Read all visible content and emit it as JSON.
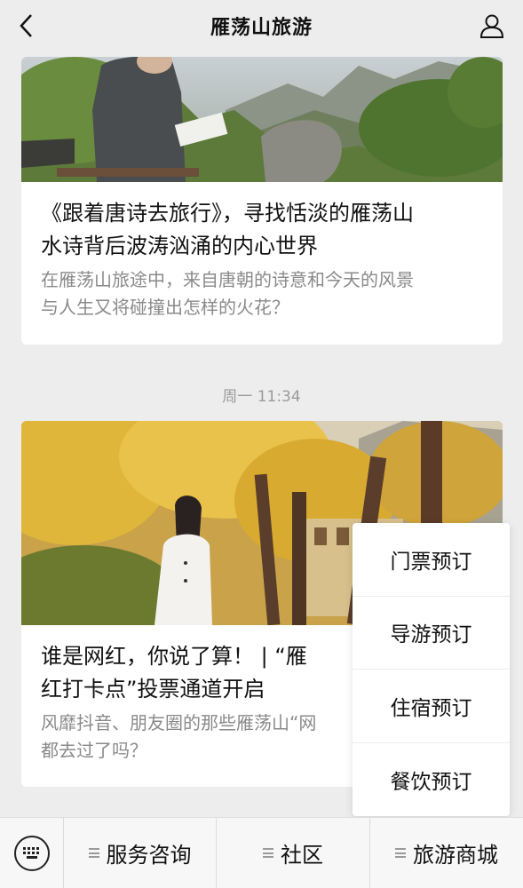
{
  "header": {
    "title": "雁荡山旅游",
    "back_icon": "chevron-left-icon",
    "profile_icon": "person-icon"
  },
  "articles": [
    {
      "title": "《跟着唐诗去旅行》，寻找恬淡的雁荡山\n水诗背后波涛汹涌的内心世界",
      "desc": "在雁荡山旅途中，来自唐朝的诗意和今天的风景\n与人生又将碰撞出怎样的火花？"
    },
    {
      "title": "谁是网红，你说了算！ | “雁\n红打卡点”投票通道开启",
      "desc": "风靡抖音、朋友圈的那些雁荡山“网\n都去过了吗？"
    }
  ],
  "timestamp": "周一 11:34",
  "popup_menu": {
    "items": [
      "门票预订",
      "导游预订",
      "住宿预订",
      "餐饮预订"
    ]
  },
  "bottom_bar": {
    "keyboard_icon": "keyboard-icon",
    "tabs": [
      "服务咨询",
      "社区",
      "旅游商城"
    ]
  },
  "colors": {
    "background": "#ededed",
    "card": "#ffffff",
    "secondary_text": "#8a8a8a"
  }
}
